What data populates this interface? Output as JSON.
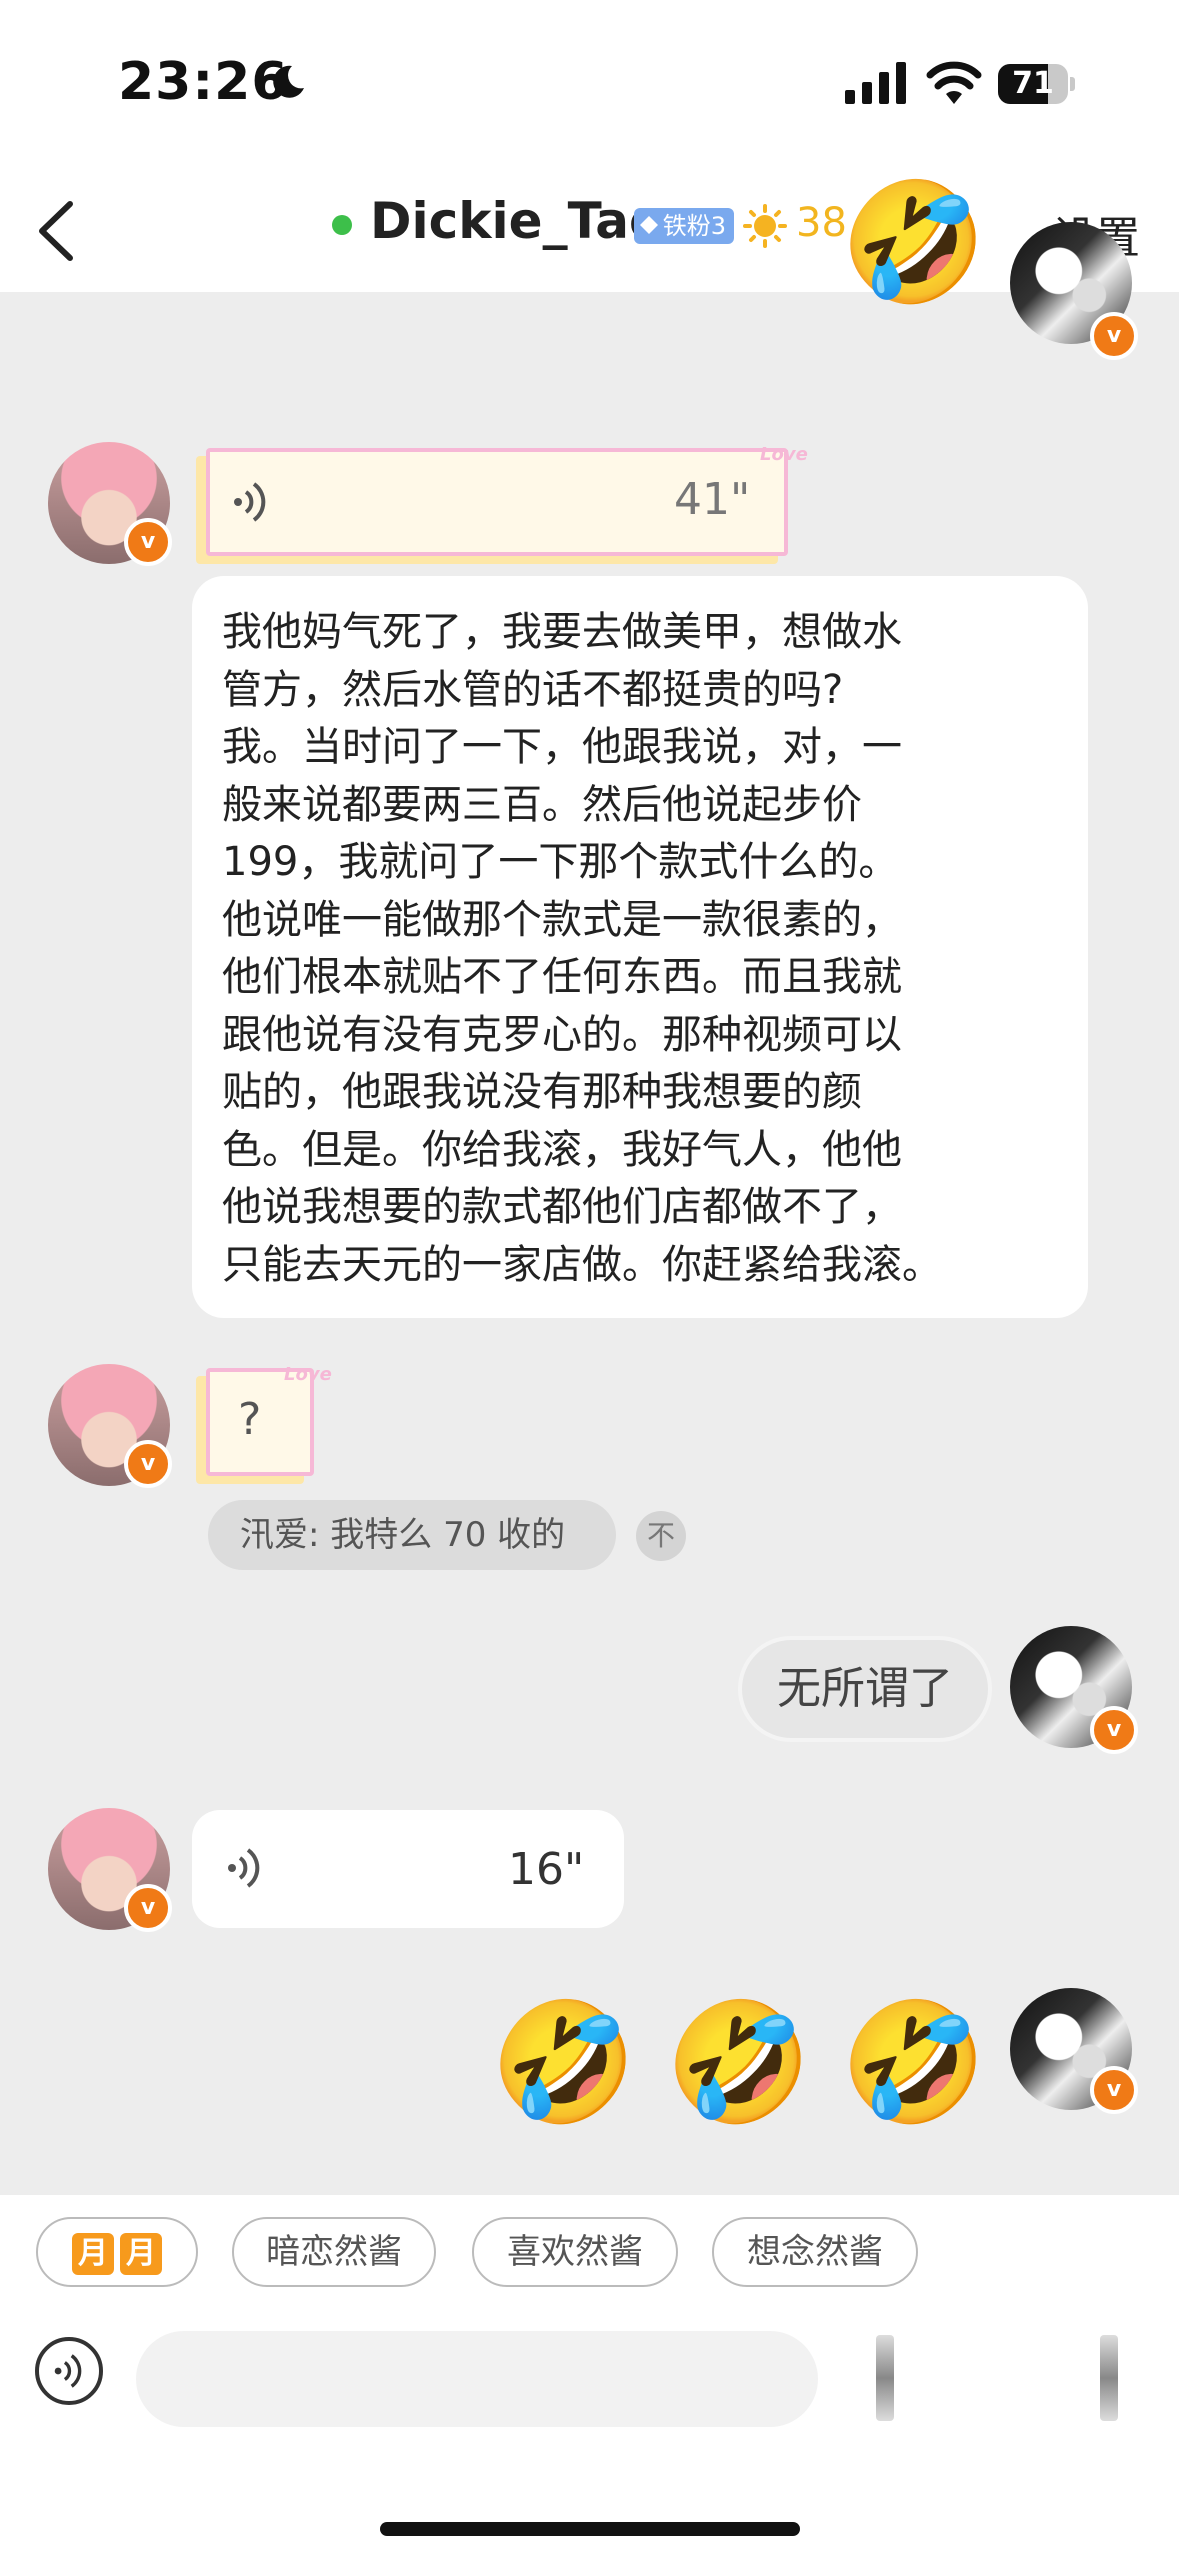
{
  "status_bar": {
    "time": "23:26",
    "battery": "71",
    "battery_level": 0.71
  },
  "header": {
    "title": "Dickie_Tae",
    "fan_badge": "铁粉3",
    "points": "38",
    "settings_label": "设置"
  },
  "messages": {
    "voice_1_duration": "41\"",
    "long_text": "我他妈气死了，我要去做美甲，想做水\n管方，然后水管的话不都挺贵的吗?\n我。当时问了一下，他跟我说，对，一\n般来说都要两三百。然后他说起步价\n199，我就问了一下那个款式什么的。\n他说唯一能做那个款式是一款很素的，\n他们根本就贴不了任何东西。而且我就\n跟他说有没有克罗心的。那种视频可以\n贴的，他跟我说没有那种我想要的颜\n色。但是。你给我滚，我好气人，他他\n他说我想要的款式都他们店都做不了，\n只能去天元的一家店做。你赶紧给我滚。",
    "note_text": "?",
    "note_love": "Love",
    "quote": "汛爱: 我特么 70 收的",
    "quote_icon": "不",
    "sticker_text": "无所谓了",
    "voice_2_duration": "16\"",
    "emoji": "🤣"
  },
  "avatar_badge": "v",
  "quick_replies": {
    "moon_tiles": [
      "月",
      "月"
    ],
    "chip_1": "暗恋然酱",
    "chip_2": "喜欢然酱",
    "chip_3": "想念然酱"
  },
  "colors": {
    "accent_orange": "#f07a16",
    "online": "#3dbf4a",
    "points": "#f2b51f",
    "badge_blue": "#7aa9ee"
  }
}
